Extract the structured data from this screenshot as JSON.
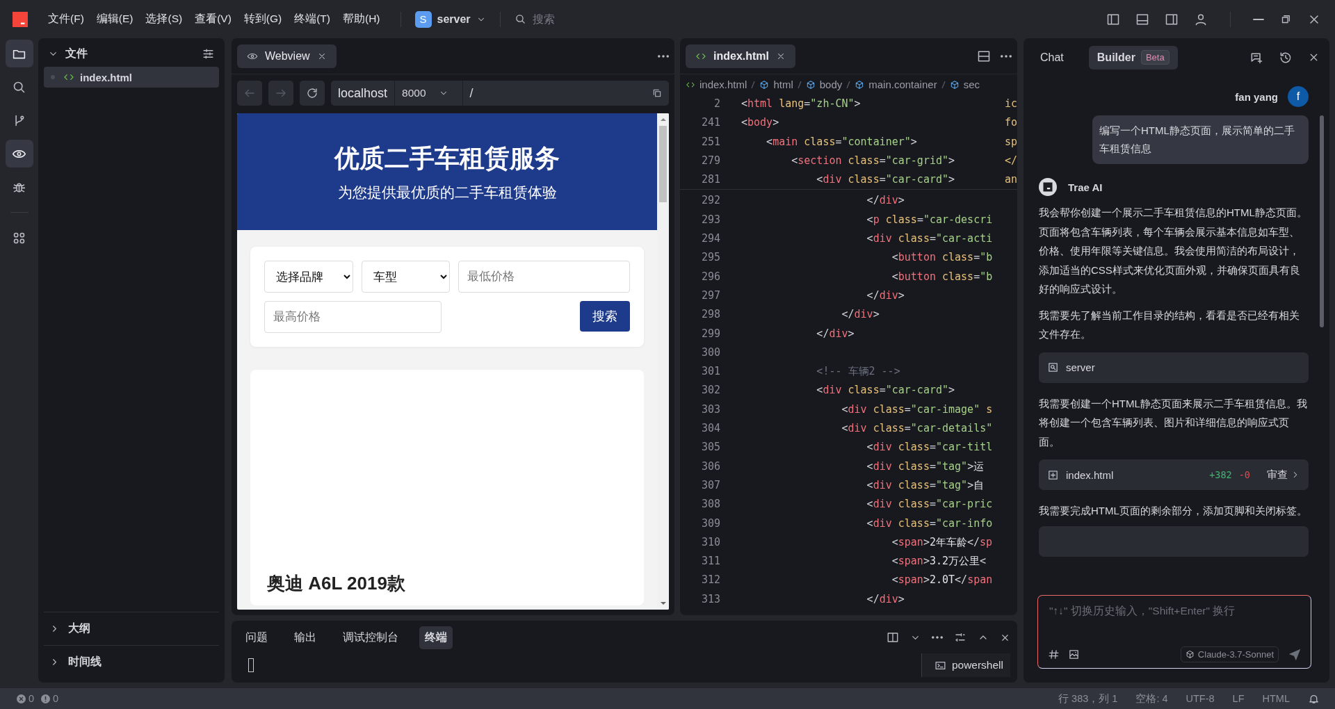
{
  "title_bar": {
    "menus": [
      "文件(F)",
      "编辑(E)",
      "选择(S)",
      "查看(V)",
      "转到(G)",
      "终端(T)",
      "帮助(H)"
    ],
    "workspace": {
      "initial": "S",
      "name": "server"
    },
    "search_placeholder": "搜索"
  },
  "activity_bar": [
    {
      "kind": "folder",
      "selected": true
    },
    {
      "kind": "search",
      "selected": false
    },
    {
      "kind": "branch",
      "selected": false
    },
    {
      "kind": "eye",
      "selected": true
    },
    {
      "kind": "bug",
      "selected": false
    },
    {
      "kind": "grid",
      "selected": false
    }
  ],
  "explorer": {
    "title": "文件",
    "expanded": true,
    "files": [
      {
        "name": "index.html",
        "selected": true
      }
    ],
    "sections": [
      {
        "title": "大纲",
        "expanded": false
      },
      {
        "title": "时间线",
        "expanded": false
      }
    ]
  },
  "webview": {
    "tab": "Webview",
    "nav_buttons": [
      {
        "kind": "back",
        "disabled": true
      },
      {
        "kind": "forward",
        "disabled": true
      },
      {
        "kind": "reload",
        "disabled": false
      }
    ],
    "host": "localhost",
    "port": "8000",
    "path": "/",
    "page": {
      "hero_title": "优质二手车租赁服务",
      "hero_subtitle": "为您提供最优质的二手车租赁体验",
      "brand_select": "选择品牌",
      "type_select": "车型",
      "min_price_placeholder": "最低价格",
      "max_price_placeholder": "最高价格",
      "search_button": "搜索",
      "car_title": "奥迪 A6L 2019款"
    }
  },
  "editor": {
    "tab": "index.html",
    "breadcrumbs": [
      "index.html",
      "html",
      "body",
      "main.container",
      "sec"
    ],
    "sticky_lines": [
      {
        "number": "2",
        "tail": "ic",
        "tokens": [
          {
            "kind": "punct",
            "text": "<"
          },
          {
            "kind": "tag",
            "text": "html"
          },
          {
            "kind": "attr",
            "text": " lang"
          },
          {
            "kind": "punct",
            "text": "="
          },
          {
            "kind": "str",
            "text": "\"zh-CN\""
          },
          {
            "kind": "punct",
            "text": ">"
          }
        ]
      },
      {
        "number": "241",
        "tail": "fo",
        "tokens": [
          {
            "kind": "punct",
            "text": "<"
          },
          {
            "kind": "tag",
            "text": "body"
          },
          {
            "kind": "punct",
            "text": ">"
          }
        ]
      },
      {
        "number": "251",
        "tail": "sp",
        "tokens": [
          {
            "kind": "punct",
            "text": "    <"
          },
          {
            "kind": "tag",
            "text": "main"
          },
          {
            "kind": "attr",
            "text": " class"
          },
          {
            "kind": "punct",
            "text": "="
          },
          {
            "kind": "str",
            "text": "\"container\""
          },
          {
            "kind": "punct",
            "text": ">"
          }
        ]
      },
      {
        "number": "279",
        "tail": "</",
        "tokens": [
          {
            "kind": "punct",
            "text": "        <"
          },
          {
            "kind": "tag",
            "text": "section"
          },
          {
            "kind": "attr",
            "text": " class"
          },
          {
            "kind": "punct",
            "text": "="
          },
          {
            "kind": "str",
            "text": "\"car-grid\""
          },
          {
            "kind": "punct",
            "text": ">"
          }
        ]
      },
      {
        "number": "281",
        "tail": "an",
        "tokens": [
          {
            "kind": "punct",
            "text": "            <"
          },
          {
            "kind": "tag",
            "text": "div"
          },
          {
            "kind": "attr",
            "text": " class"
          },
          {
            "kind": "punct",
            "text": "="
          },
          {
            "kind": "str",
            "text": "\"car-card\""
          },
          {
            "kind": "punct",
            "text": ">"
          }
        ]
      }
    ],
    "lines": [
      {
        "number": "292",
        "tokens": [
          {
            "kind": "punct",
            "text": "                    </"
          },
          {
            "kind": "tag",
            "text": "div"
          },
          {
            "kind": "punct",
            "text": ">"
          }
        ]
      },
      {
        "number": "293",
        "tokens": [
          {
            "kind": "punct",
            "text": "                    <"
          },
          {
            "kind": "tag",
            "text": "p"
          },
          {
            "kind": "attr",
            "text": " class"
          },
          {
            "kind": "punct",
            "text": "="
          },
          {
            "kind": "str",
            "text": "\"car-descri"
          }
        ]
      },
      {
        "number": "294",
        "tokens": [
          {
            "kind": "punct",
            "text": "                    <"
          },
          {
            "kind": "tag",
            "text": "div"
          },
          {
            "kind": "attr",
            "text": " class"
          },
          {
            "kind": "punct",
            "text": "="
          },
          {
            "kind": "str",
            "text": "\"car-acti"
          }
        ]
      },
      {
        "number": "295",
        "tokens": [
          {
            "kind": "punct",
            "text": "                        <"
          },
          {
            "kind": "tag",
            "text": "button"
          },
          {
            "kind": "attr",
            "text": " class"
          },
          {
            "kind": "punct",
            "text": "="
          },
          {
            "kind": "str",
            "text": "\"b"
          }
        ]
      },
      {
        "number": "296",
        "tokens": [
          {
            "kind": "punct",
            "text": "                        <"
          },
          {
            "kind": "tag",
            "text": "button"
          },
          {
            "kind": "attr",
            "text": " class"
          },
          {
            "kind": "punct",
            "text": "="
          },
          {
            "kind": "str",
            "text": "\"b"
          }
        ]
      },
      {
        "number": "297",
        "tokens": [
          {
            "kind": "punct",
            "text": "                    </"
          },
          {
            "kind": "tag",
            "text": "div"
          },
          {
            "kind": "punct",
            "text": ">"
          }
        ]
      },
      {
        "number": "298",
        "tokens": [
          {
            "kind": "punct",
            "text": "                </"
          },
          {
            "kind": "tag",
            "text": "div"
          },
          {
            "kind": "punct",
            "text": ">"
          }
        ]
      },
      {
        "number": "299",
        "tokens": [
          {
            "kind": "punct",
            "text": "            </"
          },
          {
            "kind": "tag",
            "text": "div"
          },
          {
            "kind": "punct",
            "text": ">"
          }
        ]
      },
      {
        "number": "300"
      },
      {
        "number": "301",
        "tokens": [
          {
            "kind": "comment",
            "text": "            <!-- 车辆2 -->"
          }
        ]
      },
      {
        "number": "302",
        "tokens": [
          {
            "kind": "punct",
            "text": "            <"
          },
          {
            "kind": "tag",
            "text": "div"
          },
          {
            "kind": "attr",
            "text": " class"
          },
          {
            "kind": "punct",
            "text": "="
          },
          {
            "kind": "str",
            "text": "\"car-card\""
          },
          {
            "kind": "punct",
            "text": ">"
          }
        ]
      },
      {
        "number": "303",
        "tokens": [
          {
            "kind": "punct",
            "text": "                <"
          },
          {
            "kind": "tag",
            "text": "div"
          },
          {
            "kind": "attr",
            "text": " class"
          },
          {
            "kind": "punct",
            "text": "="
          },
          {
            "kind": "str",
            "text": "\"car-image\""
          },
          {
            "kind": "attr",
            "text": " s"
          }
        ]
      },
      {
        "number": "304",
        "tokens": [
          {
            "kind": "punct",
            "text": "                <"
          },
          {
            "kind": "tag",
            "text": "div"
          },
          {
            "kind": "attr",
            "text": " class"
          },
          {
            "kind": "punct",
            "text": "="
          },
          {
            "kind": "str",
            "text": "\"car-details\""
          }
        ]
      },
      {
        "number": "305",
        "tokens": [
          {
            "kind": "punct",
            "text": "                    <"
          },
          {
            "kind": "tag",
            "text": "div"
          },
          {
            "kind": "attr",
            "text": " class"
          },
          {
            "kind": "punct",
            "text": "="
          },
          {
            "kind": "str",
            "text": "\"car-titl"
          }
        ]
      },
      {
        "number": "306",
        "tokens": [
          {
            "kind": "punct",
            "text": "                    <"
          },
          {
            "kind": "tag",
            "text": "div"
          },
          {
            "kind": "attr",
            "text": " class"
          },
          {
            "kind": "punct",
            "text": "="
          },
          {
            "kind": "str",
            "text": "\"tag\""
          },
          {
            "kind": "punct",
            "text": ">"
          },
          {
            "kind": "text",
            "text": "运"
          }
        ]
      },
      {
        "number": "307",
        "tokens": [
          {
            "kind": "punct",
            "text": "                    <"
          },
          {
            "kind": "tag",
            "text": "div"
          },
          {
            "kind": "attr",
            "text": " class"
          },
          {
            "kind": "punct",
            "text": "="
          },
          {
            "kind": "str",
            "text": "\"tag\""
          },
          {
            "kind": "punct",
            "text": ">"
          },
          {
            "kind": "text",
            "text": "自"
          }
        ]
      },
      {
        "number": "308",
        "tokens": [
          {
            "kind": "punct",
            "text": "                    <"
          },
          {
            "kind": "tag",
            "text": "div"
          },
          {
            "kind": "attr",
            "text": " class"
          },
          {
            "kind": "punct",
            "text": "="
          },
          {
            "kind": "str",
            "text": "\"car-pric"
          }
        ]
      },
      {
        "number": "309",
        "tokens": [
          {
            "kind": "punct",
            "text": "                    <"
          },
          {
            "kind": "tag",
            "text": "div"
          },
          {
            "kind": "attr",
            "text": " class"
          },
          {
            "kind": "punct",
            "text": "="
          },
          {
            "kind": "str",
            "text": "\"car-info"
          }
        ]
      },
      {
        "number": "310",
        "tokens": [
          {
            "kind": "punct",
            "text": "                        <"
          },
          {
            "kind": "tag",
            "text": "span"
          },
          {
            "kind": "punct",
            "text": ">"
          },
          {
            "kind": "text",
            "text": "2年车龄"
          },
          {
            "kind": "punct",
            "text": "</"
          },
          {
            "kind": "tag",
            "text": "sp"
          }
        ]
      },
      {
        "number": "311",
        "tokens": [
          {
            "kind": "punct",
            "text": "                        <"
          },
          {
            "kind": "tag",
            "text": "span"
          },
          {
            "kind": "punct",
            "text": ">"
          },
          {
            "kind": "text",
            "text": "3.2万公里"
          },
          {
            "kind": "punct",
            "text": "<"
          }
        ]
      },
      {
        "number": "312",
        "tokens": [
          {
            "kind": "punct",
            "text": "                        <"
          },
          {
            "kind": "tag",
            "text": "span"
          },
          {
            "kind": "punct",
            "text": ">"
          },
          {
            "kind": "text",
            "text": "2.0T"
          },
          {
            "kind": "punct",
            "text": "</"
          },
          {
            "kind": "tag",
            "text": "span"
          }
        ]
      },
      {
        "number": "313",
        "tokens": [
          {
            "kind": "punct",
            "text": "                    </"
          },
          {
            "kind": "tag",
            "text": "div"
          },
          {
            "kind": "punct",
            "text": ">"
          }
        ]
      }
    ]
  },
  "bottom_panel": {
    "tabs": [
      {
        "label": "问题",
        "selected": false
      },
      {
        "label": "输出",
        "selected": false
      },
      {
        "label": "调试控制台",
        "selected": false
      },
      {
        "label": "终端",
        "selected": true
      }
    ],
    "terminal": "powershell"
  },
  "chat": {
    "tabs": [
      {
        "label": "Chat",
        "selected": false
      },
      {
        "label": "Builder",
        "selected": true,
        "badge": "Beta"
      }
    ],
    "user": {
      "name": "fan yang",
      "initial": "f",
      "message": "编写一个HTML静态页面，展示简单的二手车租赁信息"
    },
    "assistant": "Trae AI",
    "blocks": [
      {
        "kind": "paragraph",
        "text": "我会帮你创建一个展示二手车租赁信息的HTML静态页面。页面将包含车辆列表，每个车辆会展示基本信息如车型、价格、使用年限等关键信息。我会使用简洁的布局设计，添加适当的CSS样式来优化页面外观，并确保页面具有良好的响应式设计。"
      },
      {
        "kind": "paragraph",
        "text": "我需要先了解当前工作目录的结构，看看是否已经有相关文件存在。"
      },
      {
        "kind": "tool",
        "text": "server"
      },
      {
        "kind": "paragraph",
        "text": "我需要创建一个HTML静态页面来展示二手车租赁信息。我将创建一个包含车辆列表、图片和详细信息的响应式页面。"
      },
      {
        "kind": "file",
        "text": "index.html",
        "added": "+382",
        "removed": "-0",
        "action": "审查"
      },
      {
        "kind": "paragraph",
        "text": "我需要完成HTML页面的剩余部分，添加页脚和关闭标签。"
      },
      {
        "kind": "card"
      }
    ],
    "input_placeholder": "\"↑↓\" 切换历史输入，\"Shift+Enter\" 换行",
    "model": "Claude-3.7-Sonnet"
  },
  "status_bar": {
    "errors": "0",
    "warnings": "0",
    "items": [
      "行 383，列 1",
      "空格: 4",
      "UTF-8",
      "LF",
      "HTML"
    ]
  }
}
